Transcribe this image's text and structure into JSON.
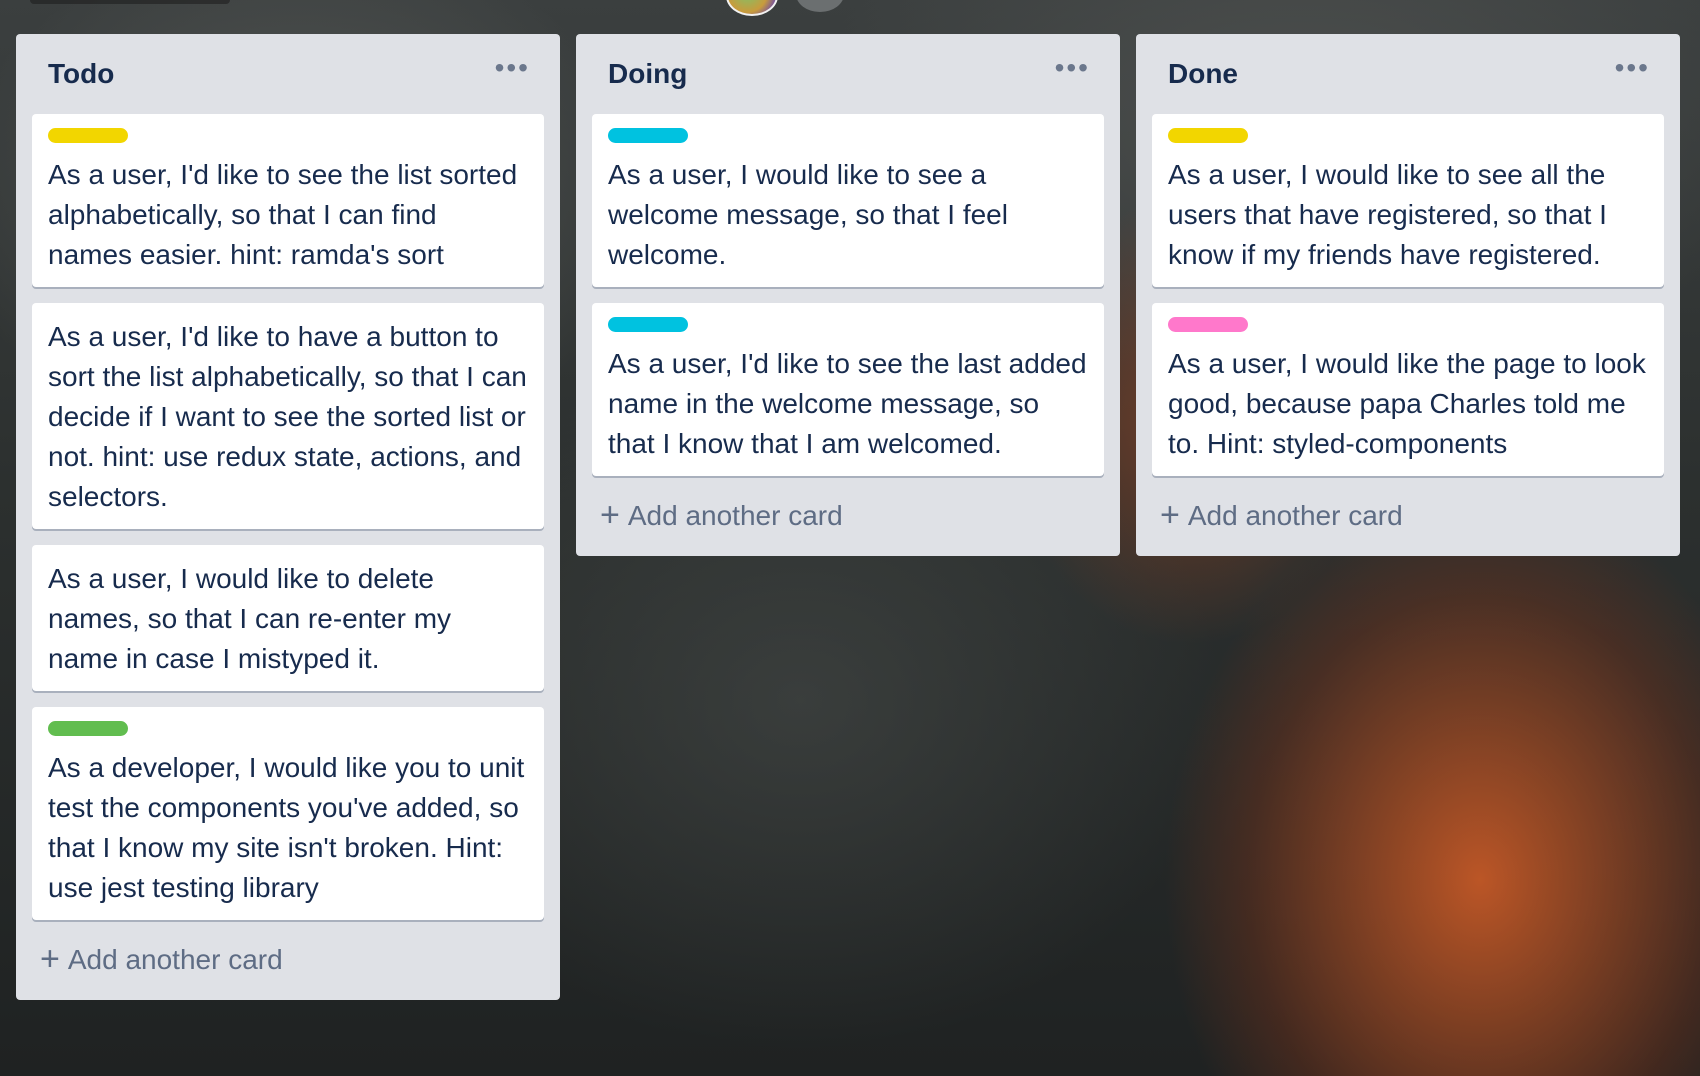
{
  "board": {
    "lists": [
      {
        "title": "Todo",
        "menu_icon": "ellipsis-icon",
        "add_card_label": "Add another card",
        "cards": [
          {
            "label_color": "#f2d600",
            "text": "As a user, I'd like to see the list sorted alphabetically, so that I can find names easier. hint: ramda's sort"
          },
          {
            "label_color": null,
            "text": "As a user, I'd like to have a button to sort the list alphabetically, so that I can decide if I want to see the sorted list or not. hint: use redux state, actions, and selectors."
          },
          {
            "label_color": null,
            "text": "As a user, I would like to delete names, so that I can re-enter my name in case I mistyped it."
          },
          {
            "label_color": "#61bd4f",
            "text": "As a developer, I would like you to unit test the components you've added, so that I know my site isn't broken. Hint: use jest testing library"
          }
        ]
      },
      {
        "title": "Doing",
        "menu_icon": "ellipsis-icon",
        "add_card_label": "Add another card",
        "cards": [
          {
            "label_color": "#00c2e0",
            "text": "As a user, I would like to see a welcome message, so that I feel welcome."
          },
          {
            "label_color": "#00c2e0",
            "text": "As a user, I'd like to see the last added name in the welcome message, so that I know that I am welcomed."
          }
        ]
      },
      {
        "title": "Done",
        "menu_icon": "ellipsis-icon",
        "add_card_label": "Add another card",
        "cards": [
          {
            "label_color": "#f2d600",
            "text": "As a user, I would like to see all the users that have registered, so that I know if my friends have registered."
          },
          {
            "label_color": "#ff78cb",
            "text": "As a user, I would like the page to look good, because papa Charles told me to. Hint: styled-components"
          }
        ]
      }
    ]
  }
}
